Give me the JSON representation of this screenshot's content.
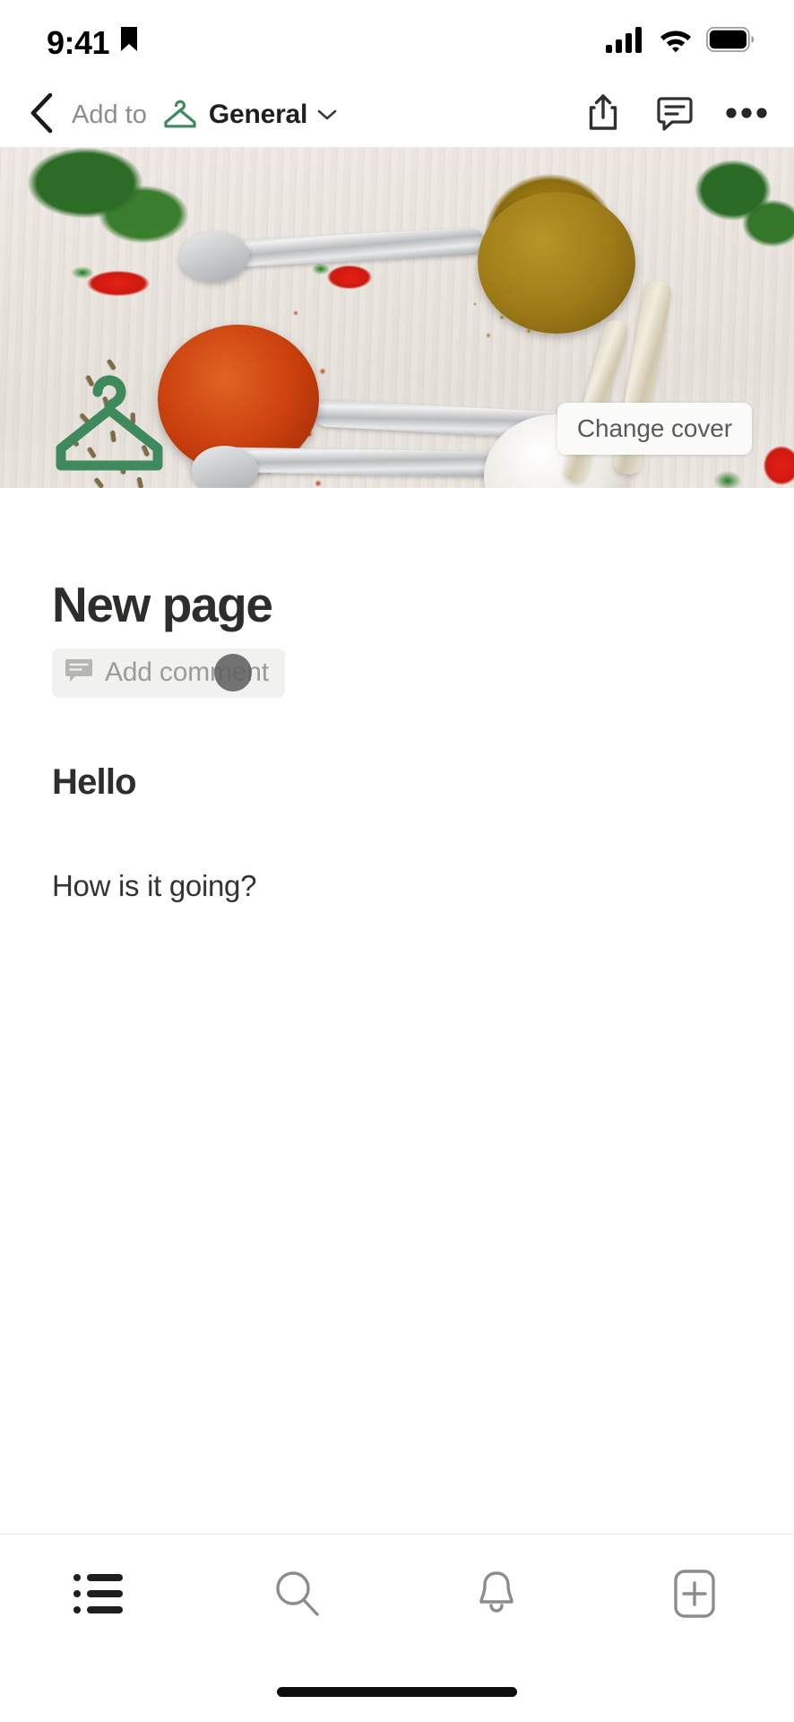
{
  "status_bar": {
    "time": "9:41",
    "location_icon": "location-arrow-icon",
    "cellular_icon": "cellular-signal-icon",
    "wifi_icon": "wifi-icon",
    "battery_icon": "battery-full-icon"
  },
  "nav_bar": {
    "back_icon": "chevron-left-icon",
    "add_to_label": "Add to",
    "workspace_icon": "clothes-hanger-icon",
    "workspace_name": "General",
    "workspace_chevron_icon": "chevron-down-icon",
    "share_icon": "share-icon",
    "comment_icon": "comment-icon",
    "more_icon": "more-horizontal-icon"
  },
  "cover": {
    "change_cover_label": "Change cover",
    "alt": "spices-photo-cover"
  },
  "page": {
    "icon": "clothes-hanger-icon",
    "icon_color": "#3f8a5c",
    "title": "New page",
    "add_comment_label": "Add comment",
    "add_comment_icon": "comment-icon",
    "blocks": [
      {
        "type": "heading",
        "text": "Hello"
      },
      {
        "type": "paragraph",
        "text": "How is it going?"
      }
    ]
  },
  "tab_bar": {
    "tabs": [
      {
        "name": "home",
        "icon": "list-icon",
        "active": true
      },
      {
        "name": "search",
        "icon": "search-icon",
        "active": false
      },
      {
        "name": "inbox",
        "icon": "bell-icon",
        "active": false
      },
      {
        "name": "new-page",
        "icon": "new-page-plus-icon",
        "active": false
      }
    ]
  },
  "colors": {
    "accent_green": "#3f8a5c",
    "text_primary": "#2d2d2c",
    "text_muted": "#8d8d8d",
    "pill_bg": "#f1f1f0"
  }
}
